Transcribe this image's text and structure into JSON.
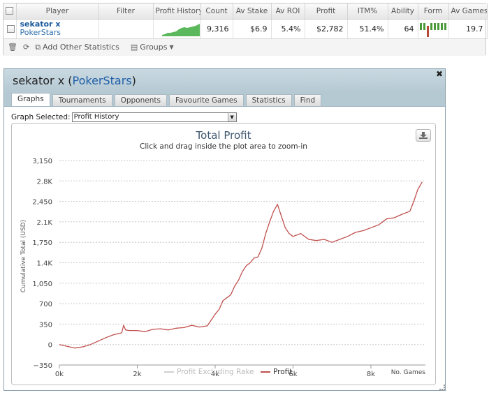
{
  "stats_table": {
    "columns": [
      "Player",
      "Filter",
      "Profit History",
      "Count",
      "Av Stake",
      "Av ROI",
      "Profit",
      "ITM%",
      "Ability",
      "Form",
      "Av Games"
    ],
    "row": {
      "player_name": "sekator x",
      "player_site": "PokerStars",
      "filter": "",
      "count": "9,316",
      "av_stake": "$6.9",
      "av_roi": "5.4%",
      "profit": "$2,782",
      "itm": "51.4%",
      "ability": "64",
      "av_games": "19.7",
      "form": [
        "W",
        "W",
        "L",
        "W",
        "W",
        "W",
        "W",
        "W"
      ]
    },
    "toolbar": {
      "add_stats_label": "Add Other Statistics",
      "groups_label": "Groups"
    }
  },
  "player_window": {
    "title_name": "sekator x",
    "title_site": "PokerStars",
    "tabs": [
      "Graphs",
      "Tournaments",
      "Opponents",
      "Favourite Games",
      "Statistics",
      "Find"
    ],
    "active_tab": "Graphs",
    "graph_selected_label": "Graph Selected:",
    "graph_selected_value": "Profit History"
  },
  "colors": {
    "profit_line": "#c0504d",
    "excluding_rake_line": "#d0d0d0",
    "sparkline_fill": "#5cb85c",
    "header_bg": "#b5c9d3"
  },
  "chart_data": {
    "type": "line",
    "title": "Total Profit",
    "subtitle": "Click and drag inside the plot area to zoom-in",
    "ylabel": "Cumulative Total (USD)",
    "xlabel": "No. Games",
    "ylim": [
      -350,
      3150
    ],
    "xlim": [
      0,
      9400
    ],
    "y_ticks": [
      -350,
      0,
      350,
      700,
      1050,
      1400,
      1750,
      2100,
      2450,
      2800,
      3150
    ],
    "y_tick_labels": [
      "−350",
      "0",
      "350",
      "700",
      "1,050",
      "1.4K",
      "1,750",
      "2.1K",
      "2,450",
      "2.8K",
      "3,150"
    ],
    "x_ticks": [
      0,
      2000,
      4000,
      6000,
      8000
    ],
    "x_tick_labels": [
      "0k",
      "2k",
      "4k",
      "6k",
      "8k"
    ],
    "grid": true,
    "legend": [
      "Profit Excluding Rake",
      "Profit"
    ],
    "legend_position": "bottom",
    "series": [
      {
        "name": "Profit",
        "x": [
          0,
          200,
          400,
          600,
          800,
          1000,
          1200,
          1400,
          1600,
          1650,
          1700,
          1800,
          2000,
          2200,
          2400,
          2600,
          2800,
          3000,
          3200,
          3400,
          3600,
          3800,
          3900,
          4000,
          4100,
          4200,
          4300,
          4400,
          4500,
          4600,
          4700,
          4800,
          4900,
          5000,
          5100,
          5200,
          5300,
          5400,
          5500,
          5600,
          5700,
          5800,
          5900,
          6000,
          6200,
          6400,
          6600,
          6800,
          7000,
          7200,
          7400,
          7600,
          7800,
          8000,
          8200,
          8400,
          8600,
          8800,
          9000,
          9100,
          9200,
          9316
        ],
        "y": [
          0,
          -30,
          -60,
          -40,
          0,
          60,
          120,
          170,
          200,
          330,
          250,
          240,
          240,
          220,
          260,
          270,
          250,
          280,
          290,
          330,
          300,
          320,
          420,
          520,
          600,
          750,
          800,
          850,
          1000,
          1100,
          1250,
          1350,
          1400,
          1480,
          1500,
          1650,
          1900,
          2100,
          2280,
          2400,
          2200,
          2000,
          1900,
          1850,
          1900,
          1800,
          1780,
          1800,
          1750,
          1800,
          1850,
          1920,
          1950,
          2000,
          2050,
          2150,
          2170,
          2230,
          2280,
          2450,
          2650,
          2782
        ]
      }
    ]
  }
}
